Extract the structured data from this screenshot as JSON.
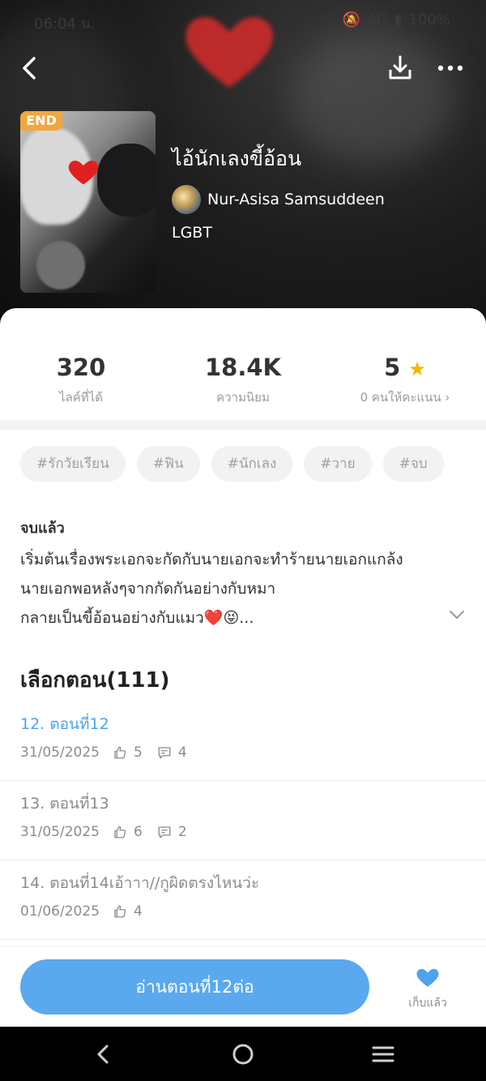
{
  "status_bar": {
    "time": "06:04 น.",
    "network": "4G",
    "battery": "100%"
  },
  "story": {
    "badge": "END",
    "title": "ไอ้นักเลงขี้อ้อน",
    "author": "Nur-Asisa Samsuddeen",
    "genre": "LGBT"
  },
  "stats": [
    {
      "value": "320",
      "label": "ไลค์ที่ได้"
    },
    {
      "value": "18.4K",
      "label": "ความนิยม"
    },
    {
      "value": "5",
      "label": "0 คนให้คะแนน"
    }
  ],
  "tags": [
    "#รักวัยเรียน",
    "#ฟิน",
    "#นักเลง",
    "#วาย",
    "#จบ"
  ],
  "description": {
    "status": "จบแล้ว",
    "lines": [
      "เริ่มต้นเรื่องพระเอกจะกัดกับนายเอกจะทำร้ายนายเอกแกล้ง",
      "นายเอกพอหลังๆจากกัดกันอย่างกับหมา",
      "กลายเป็นขี้อ้อนอย่างกับแมว❤️😝..."
    ]
  },
  "episodes_section": {
    "title": "เลือกตอน(111)"
  },
  "episodes": [
    {
      "title": "12. ตอนที่12",
      "date": "31/05/2025",
      "likes": "5",
      "comments": "4",
      "active": true
    },
    {
      "title": "13. ตอนที่13",
      "date": "31/05/2025",
      "likes": "6",
      "comments": "2",
      "active": false
    },
    {
      "title": "14. ตอนที่14เอ้าาา//กูผิดตรงไหนว่ะ",
      "date": "01/06/2025",
      "likes": "4",
      "comments": "",
      "active": false
    }
  ],
  "actions": {
    "read_button": "อ่านตอนที่12ต่อ",
    "favorite_label": "เก็บแล้ว"
  },
  "colors": {
    "accent": "#5aa9ee",
    "badge": "#f3a63c",
    "star": "#f5b400",
    "heart": "#e02020"
  }
}
